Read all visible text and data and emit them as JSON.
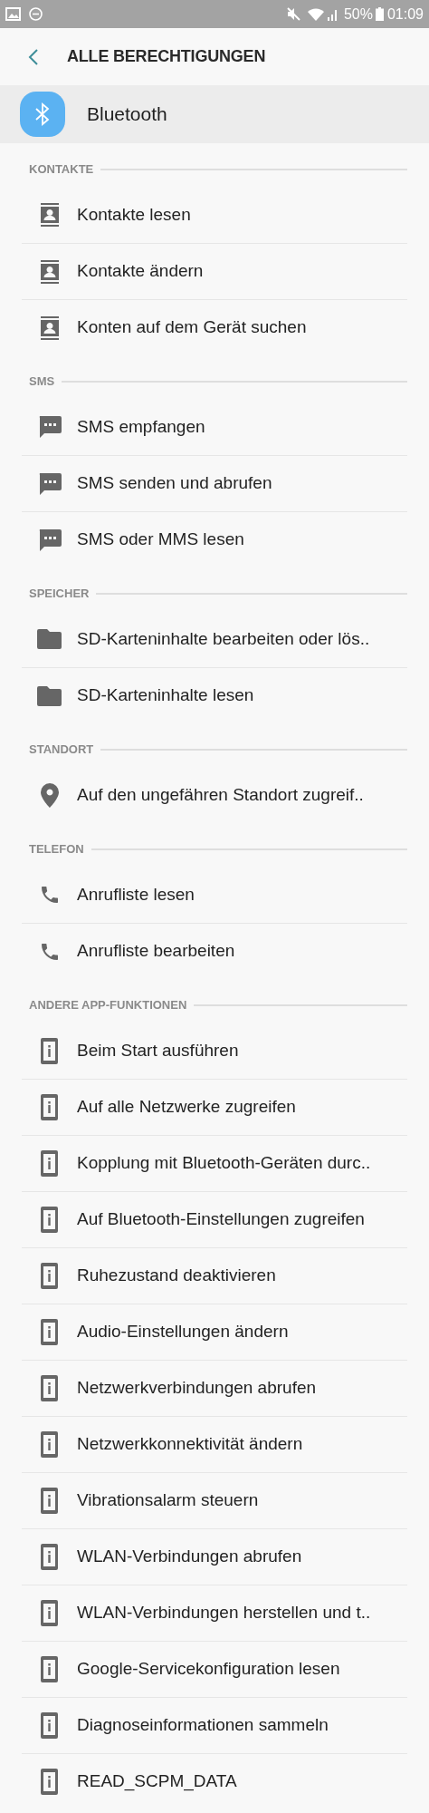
{
  "status_bar": {
    "battery": "50%",
    "time": "01:09"
  },
  "header": {
    "title": "ALLE BERECHTIGUNGEN"
  },
  "app": {
    "name": "Bluetooth"
  },
  "sections": [
    {
      "title": "KONTAKTE",
      "items": [
        {
          "kind": "contacts",
          "label": "Kontakte lesen"
        },
        {
          "kind": "contacts",
          "label": "Kontakte ändern"
        },
        {
          "kind": "contacts",
          "label": "Konten auf dem Gerät suchen"
        }
      ]
    },
    {
      "title": "SMS",
      "items": [
        {
          "kind": "sms",
          "label": "SMS empfangen"
        },
        {
          "kind": "sms",
          "label": "SMS senden und abrufen"
        },
        {
          "kind": "sms",
          "label": "SMS oder MMS lesen"
        }
      ]
    },
    {
      "title": "SPEICHER",
      "items": [
        {
          "kind": "storage",
          "label": "SD-Karteninhalte bearbeiten oder lös.."
        },
        {
          "kind": "storage",
          "label": "SD-Karteninhalte lesen"
        }
      ]
    },
    {
      "title": "STANDORT",
      "items": [
        {
          "kind": "location",
          "label": "Auf den ungefähren Standort zugreif.."
        }
      ]
    },
    {
      "title": "TELEFON",
      "items": [
        {
          "kind": "phone",
          "label": "Anrufliste lesen"
        },
        {
          "kind": "phone",
          "label": "Anrufliste bearbeiten"
        }
      ]
    },
    {
      "title": "ANDERE APP-FUNKTIONEN",
      "items": [
        {
          "kind": "device",
          "label": "Beim Start ausführen"
        },
        {
          "kind": "device",
          "label": "Auf alle Netzwerke zugreifen"
        },
        {
          "kind": "device",
          "label": "Kopplung mit Bluetooth-Geräten durc.."
        },
        {
          "kind": "device",
          "label": "Auf Bluetooth-Einstellungen zugreifen"
        },
        {
          "kind": "device",
          "label": "Ruhezustand deaktivieren"
        },
        {
          "kind": "device",
          "label": "Audio-Einstellungen ändern"
        },
        {
          "kind": "device",
          "label": "Netzwerkverbindungen abrufen"
        },
        {
          "kind": "device",
          "label": "Netzwerkkonnektivität ändern"
        },
        {
          "kind": "device",
          "label": "Vibrationsalarm steuern"
        },
        {
          "kind": "device",
          "label": "WLAN-Verbindungen abrufen"
        },
        {
          "kind": "device",
          "label": "WLAN-Verbindungen herstellen und t.."
        },
        {
          "kind": "device",
          "label": "Google-Servicekonfiguration lesen"
        },
        {
          "kind": "device",
          "label": "Diagnoseinformationen sammeln"
        },
        {
          "kind": "device",
          "label": "READ_SCPM_DATA"
        }
      ]
    }
  ]
}
